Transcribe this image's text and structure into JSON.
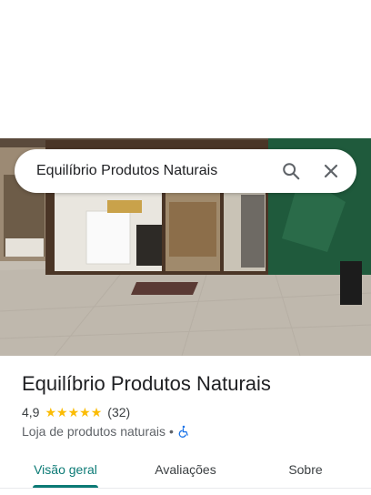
{
  "search": {
    "query": "Equilíbrio Produtos Naturais"
  },
  "place": {
    "name": "Equilíbrio Produtos Naturais",
    "rating": "4,9",
    "stars": 5,
    "review_count": "(32)",
    "category": "Loja de produtos naturais",
    "separator": "•"
  },
  "tabs": [
    {
      "label": "Visão geral",
      "active": true
    },
    {
      "label": "Avaliações",
      "active": false
    },
    {
      "label": "Sobre",
      "active": false
    }
  ],
  "colors": {
    "accent": "#0b7a75",
    "star": "#fbbc04",
    "accessibility": "#1a73e8"
  },
  "icons": {
    "search": "search-icon",
    "close": "close-icon",
    "accessibility": "wheelchair-icon"
  }
}
